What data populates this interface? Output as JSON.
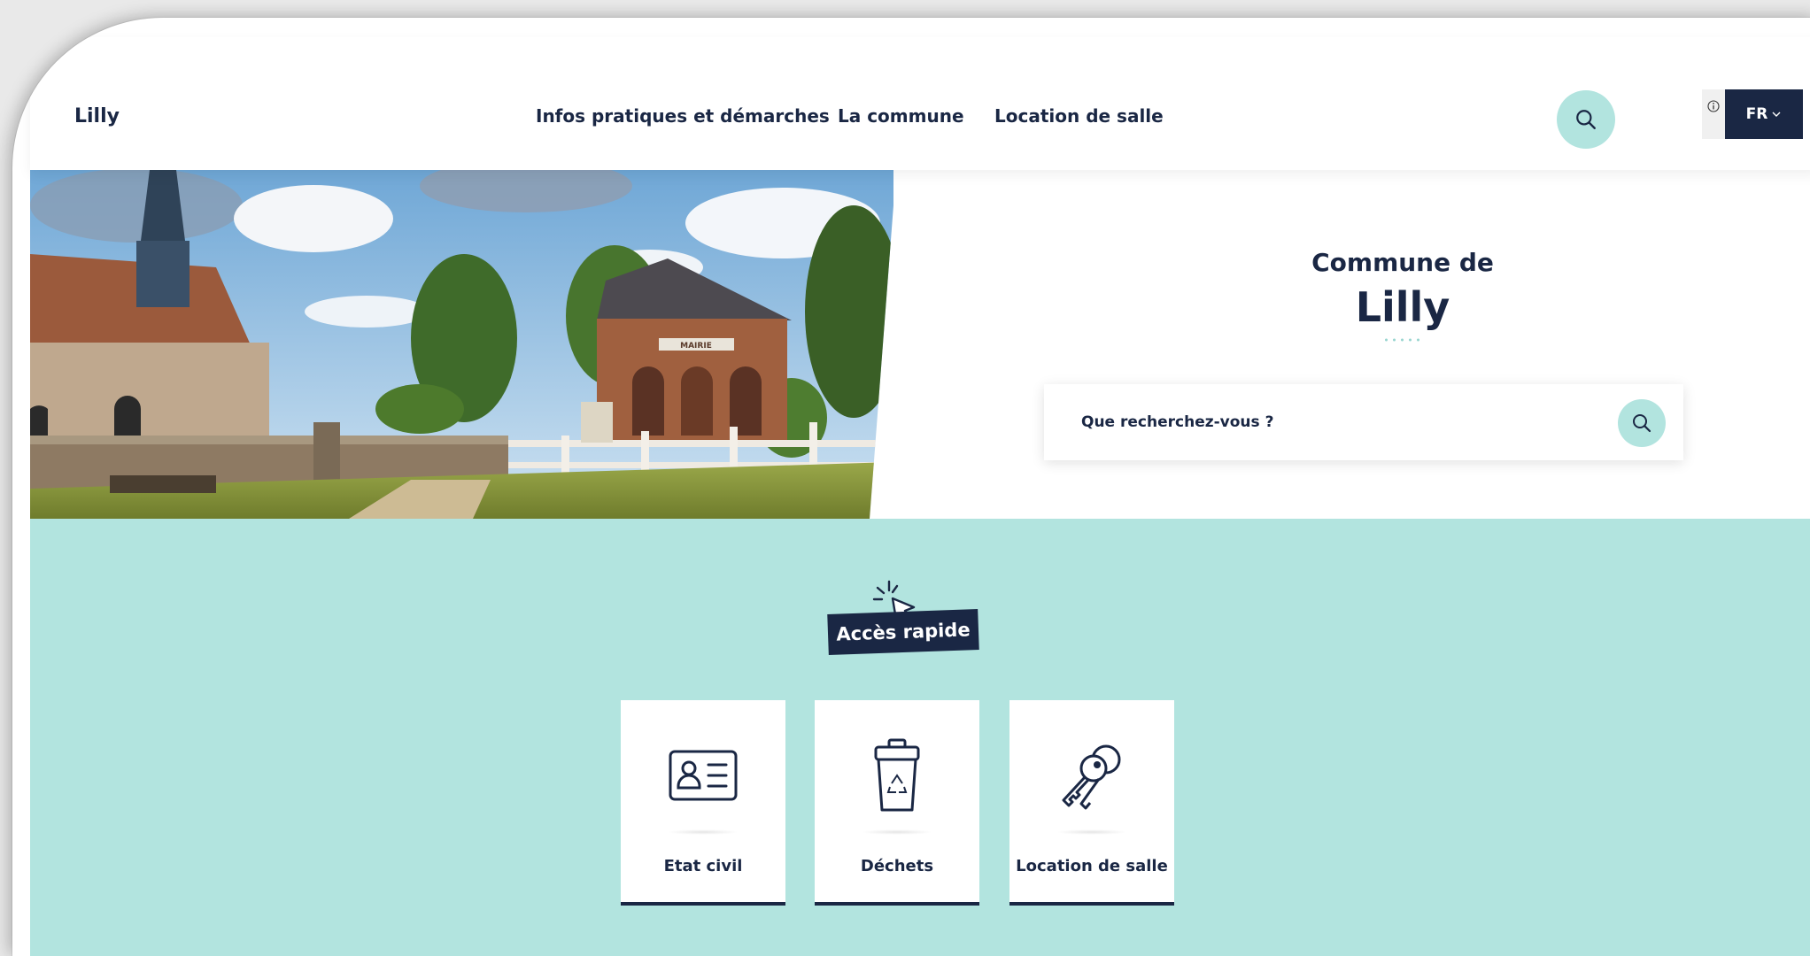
{
  "header": {
    "site_name": "Lilly",
    "nav": [
      {
        "label": "Infos pratiques et démarches"
      },
      {
        "label": "La commune"
      },
      {
        "label": "Location de salle"
      }
    ],
    "language": "FR"
  },
  "hero": {
    "title_prefix": "Commune de",
    "title_name": "Lilly",
    "photo_sign": "MAIRIE",
    "search": {
      "placeholder": "Que recherchez-vous ?",
      "value": ""
    }
  },
  "quick_access": {
    "title": "Accès rapide",
    "cards": [
      {
        "label": "Etat civil",
        "icon": "id-card-icon"
      },
      {
        "label": "Déchets",
        "icon": "recycling-bin-icon"
      },
      {
        "label": "Location de salle",
        "icon": "keys-icon"
      }
    ]
  },
  "colors": {
    "navy": "#1a2744",
    "mint": "#b2e4df",
    "white": "#ffffff"
  }
}
